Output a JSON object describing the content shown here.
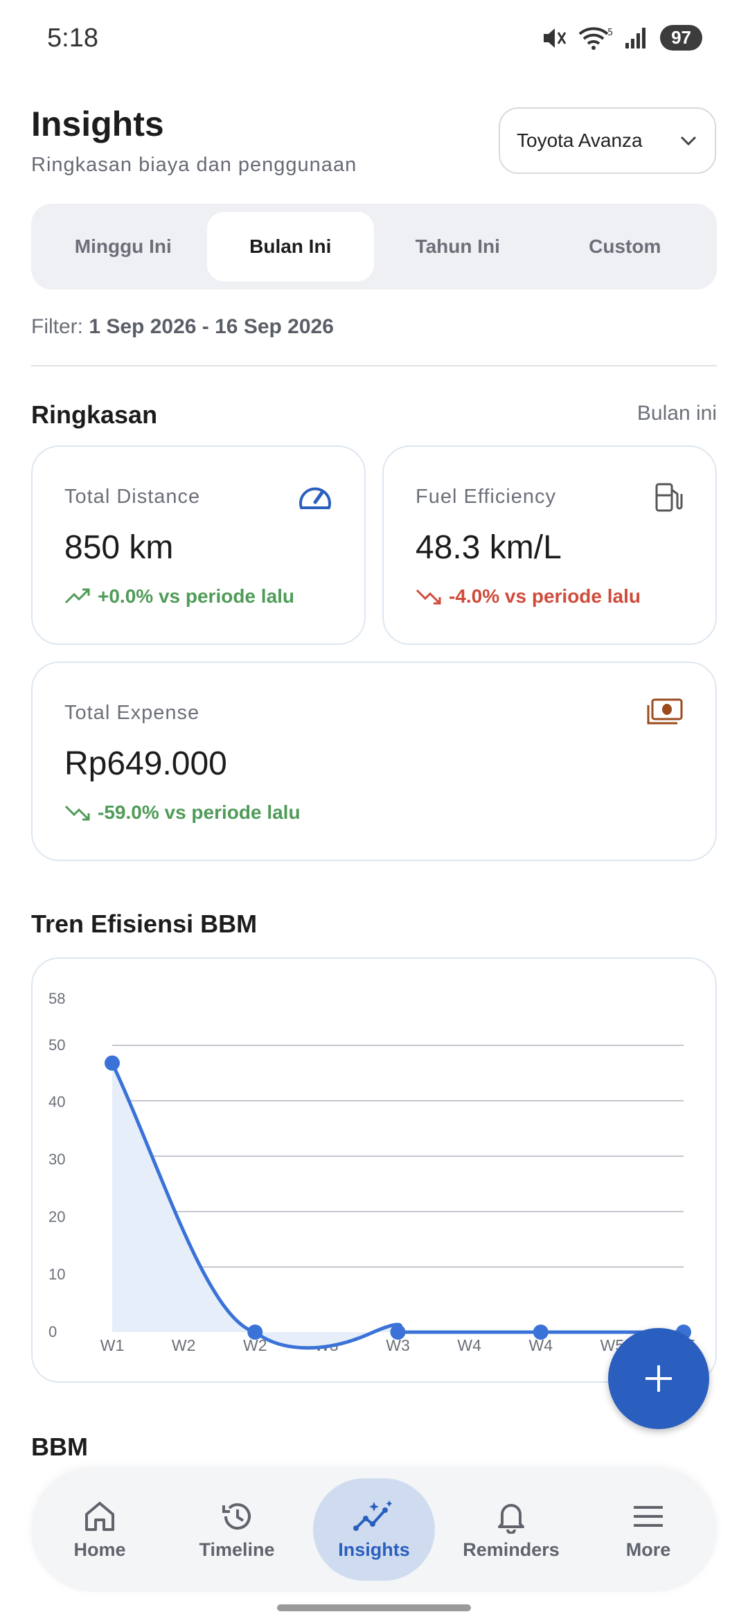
{
  "status": {
    "time": "5:18",
    "battery": "97"
  },
  "header": {
    "title": "Insights",
    "subtitle": "Ringkasan biaya dan penggunaan",
    "vehicle": "Toyota Avanza"
  },
  "tabs": [
    {
      "label": "Minggu Ini",
      "active": false
    },
    {
      "label": "Bulan Ini",
      "active": true
    },
    {
      "label": "Tahun Ini",
      "active": false
    },
    {
      "label": "Custom",
      "active": false
    }
  ],
  "filter": {
    "prefix": "Filter:",
    "range": "1 Sep 2026 - 16 Sep 2026"
  },
  "summary": {
    "heading": "Ringkasan",
    "period": "Bulan ini",
    "distance": {
      "label": "Total Distance",
      "value": "850 km",
      "change": "+0.0% vs periode lalu"
    },
    "efficiency": {
      "label": "Fuel Efficiency",
      "value": "48.3 km/L",
      "change": "-4.0% vs periode lalu"
    },
    "expense": {
      "label": "Total Expense",
      "value": "Rp649.000",
      "change": "-59.0% vs periode lalu"
    }
  },
  "trend": {
    "heading": "Tren Efisiensi BBM"
  },
  "bbm": {
    "heading": "BBM"
  },
  "colors": {
    "primary": "#2a5fbf",
    "line": "#3a72d8",
    "positive": "#4f9b58",
    "negative": "#cf4b3a"
  },
  "chart_data": {
    "type": "line",
    "categories": [
      "W1",
      "W2",
      "W2",
      "W3",
      "W3",
      "W4",
      "W4",
      "W5",
      "W5"
    ],
    "points": [
      {
        "x_index": 0,
        "y": 48.3
      },
      {
        "x_index": 2,
        "y": 0
      },
      {
        "x_index": 4,
        "y": 0
      },
      {
        "x_index": 6,
        "y": 0
      },
      {
        "x_index": 8,
        "y": 0
      }
    ],
    "y_ticks": [
      0,
      10,
      20,
      30,
      40,
      50,
      58
    ],
    "ylim": [
      0,
      58
    ],
    "grid": true,
    "smooth": true,
    "fill": true
  },
  "nav": [
    {
      "label": "Home",
      "icon": "home-icon",
      "active": false
    },
    {
      "label": "Timeline",
      "icon": "history-icon",
      "active": false
    },
    {
      "label": "Insights",
      "icon": "insights-icon",
      "active": true
    },
    {
      "label": "Reminders",
      "icon": "bell-icon",
      "active": false
    },
    {
      "label": "More",
      "icon": "menu-icon",
      "active": false
    }
  ]
}
